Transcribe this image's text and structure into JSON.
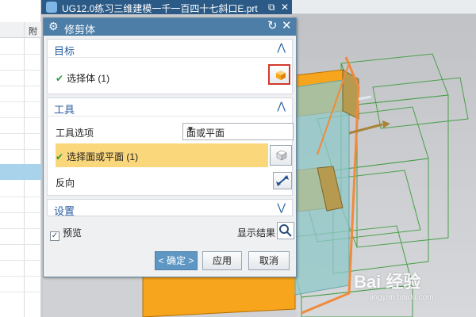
{
  "window": {
    "title": "UG12.0练习三维建模一千一百四十七斜口E.prt",
    "left_column_header": "附"
  },
  "dialog": {
    "title": "修剪体",
    "sections": {
      "target": {
        "title": "目标",
        "select_label": "选择体 (1)"
      },
      "tool": {
        "title": "工具",
        "option_label": "工具选项",
        "option_value": "面或平面",
        "select_label": "选择面或平面 (1)",
        "reverse_label": "反向"
      },
      "settings": {
        "title": "设置"
      }
    },
    "preview_label": "预览",
    "show_result_label": "显示结果",
    "buttons": {
      "ok": "< 确定 >",
      "apply": "应用",
      "cancel": "取消"
    }
  },
  "watermark": {
    "brand": "Bai 经验",
    "url": "jingyan.baidu.com"
  },
  "colors": {
    "titlebar": "#2b5a86",
    "dialog_header": "#4c7ea8",
    "section_title": "#2a5fa3",
    "highlight": "#fbd77c",
    "model_orange": "#f7a51c",
    "model_teal": "#8fc8c8",
    "wireframe_green": "#4aa04a"
  }
}
